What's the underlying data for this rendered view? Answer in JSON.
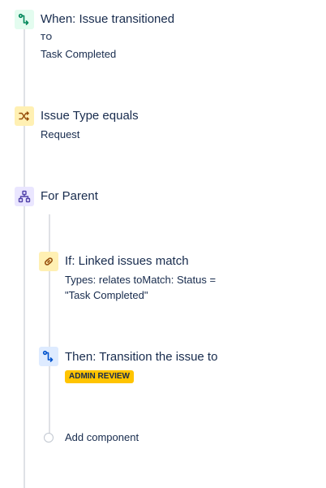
{
  "trigger": {
    "icon": "trigger-icon",
    "title": "When: Issue transitioned",
    "to_label": "TO",
    "to_value": "Task Completed",
    "color": "#e3fcef"
  },
  "condition": {
    "icon": "shuffle-icon",
    "title": "Issue Type equals",
    "value": "Request",
    "color": "#fff0b3"
  },
  "branch": {
    "icon": "hierarchy-icon",
    "title": "For Parent",
    "color": "#eae6ff"
  },
  "if_condition": {
    "icon": "link-icon",
    "title": "If: Linked issues match",
    "detail_line1": "Types: relates toMatch: Status =",
    "detail_line2": "\"Task Completed\"",
    "color": "#fff0b3"
  },
  "action": {
    "icon": "transition-icon",
    "title": "Then: Transition the issue to",
    "badge": "ADMIN REVIEW",
    "color": "#deebff",
    "badge_color": "#ffc400"
  },
  "add_component": {
    "label": "Add component"
  }
}
